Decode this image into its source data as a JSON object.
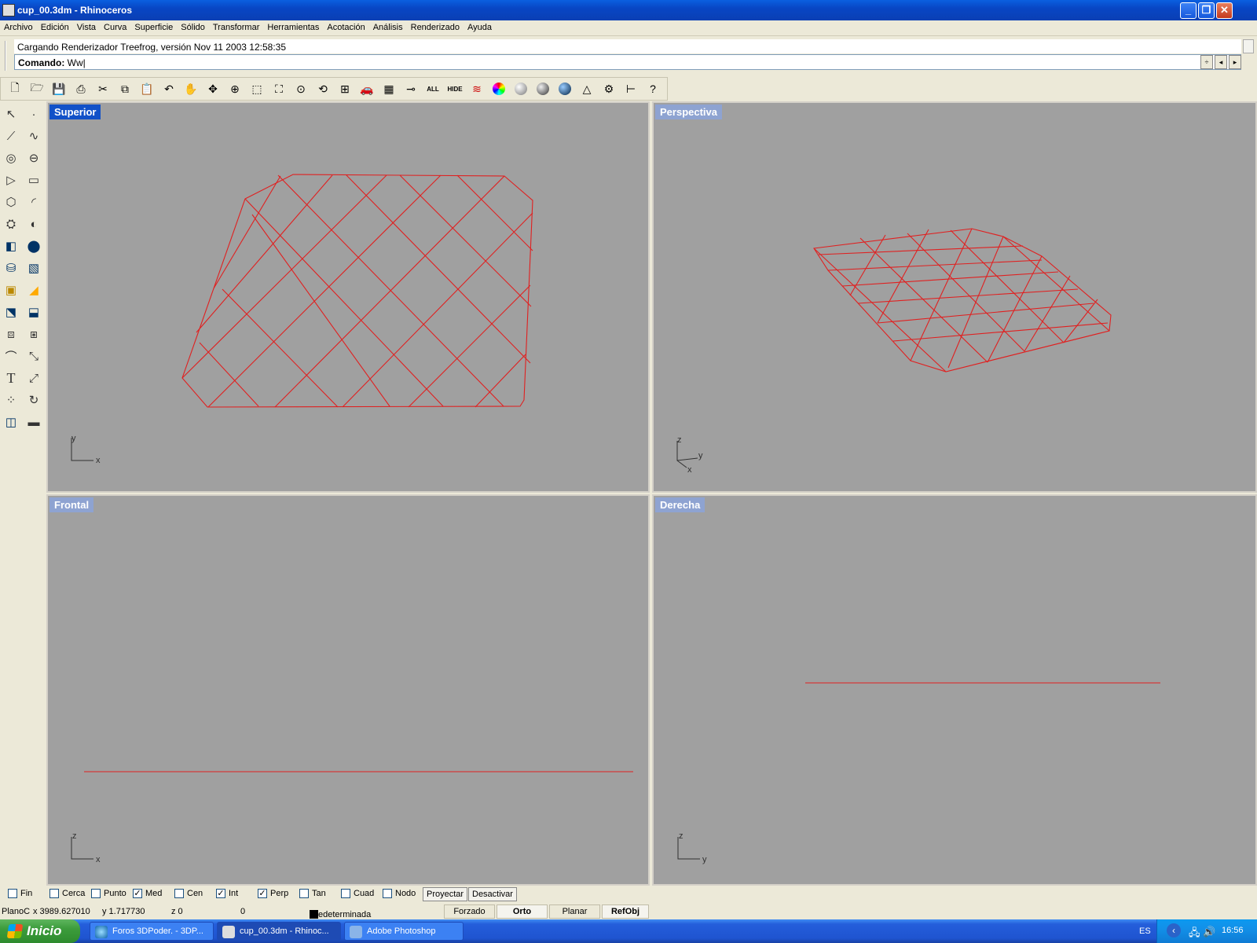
{
  "window": {
    "title": "cup_00.3dm - Rhinoceros",
    "minimize": "_",
    "restore": "❐",
    "close": "✕"
  },
  "menu": [
    "Archivo",
    "Edición",
    "Vista",
    "Curva",
    "Superficie",
    "Sólido",
    "Transformar",
    "Herramientas",
    "Acotación",
    "Análisis",
    "Renderizado",
    "Ayuda"
  ],
  "command": {
    "history": "Cargando Renderizador Treefrog, versión Nov 11 2003 12:58:35",
    "prompt": "Comando:",
    "value": "Ww"
  },
  "toolbar": {
    "icons": [
      "new-icon",
      "open-icon",
      "save-icon",
      "print-icon",
      "cut-icon",
      "copy-icon",
      "paste-icon",
      "undo-icon",
      "pan-icon",
      "rotate-view-icon",
      "zoom-dynamic-icon",
      "zoom-window-icon",
      "zoom-extents-icon",
      "zoom-selected-icon",
      "undo-view-icon",
      "four-viewports-icon",
      "car-icon",
      "grid-icon",
      "point-icon",
      "show-all-icon",
      "hide-icon",
      "layer-icon",
      "color-wheel-icon",
      "shaded-sphere-icon",
      "rendered-sphere-icon",
      "blue-sphere-icon",
      "light-icon",
      "settings-icon",
      "dimension-icon",
      "help-icon"
    ],
    "labels": {
      "all": "ALL",
      "hide": "HIDE"
    }
  },
  "left_toolbar": [
    "select-arrow-icon",
    "point-icon",
    "polyline-icon",
    "curve-icon",
    "circle-icon",
    "ellipse-icon",
    "polygon-icon",
    "rectangle-icon",
    "hexagon-icon",
    "arc-icon",
    "extrude-icon",
    "revolve-icon",
    "box-icon",
    "solid-icon",
    "cylinder-icon",
    "surface-icon",
    "box-edit-icon",
    "fillet-icon",
    "curve-edit-icon",
    "split-icon",
    "transform-icon",
    "array-icon",
    "curve-from-object-icon",
    "dimension-icon",
    "text-icon",
    "scale-icon",
    "array-grid-icon",
    "rotate-icon",
    "properties-icon",
    "line-icon"
  ],
  "left_toolbar_text": "T",
  "viewports": [
    {
      "name": "Superior",
      "active": true,
      "axes": [
        "y",
        "x"
      ]
    },
    {
      "name": "Perspectiva",
      "active": false,
      "axes": [
        "z",
        "y",
        "x"
      ]
    },
    {
      "name": "Frontal",
      "active": false,
      "axes": [
        "z",
        "x"
      ]
    },
    {
      "name": "Derecha",
      "active": false,
      "axes": [
        "z",
        "y"
      ]
    }
  ],
  "osnap": {
    "items": [
      {
        "label": "Fin",
        "checked": false
      },
      {
        "label": "Cerca",
        "checked": false
      },
      {
        "label": "Punto",
        "checked": false
      },
      {
        "label": "Med",
        "checked": true
      },
      {
        "label": "Cen",
        "checked": false
      },
      {
        "label": "Int",
        "checked": true
      },
      {
        "label": "Perp",
        "checked": true
      },
      {
        "label": "Tan",
        "checked": false
      },
      {
        "label": "Cuad",
        "checked": false
      },
      {
        "label": "Nodo",
        "checked": false
      }
    ],
    "project": "Proyectar",
    "disable": "Desactivar"
  },
  "status": {
    "plane": "PlanoC",
    "x": "x 3989.627010",
    "y": "y 1.717730",
    "z": "z 0",
    "extra": "0",
    "layer": "Predeterminada",
    "snap": "Forzado",
    "ortho": "Orto",
    "planar": "Planar",
    "osnap": "RefObj"
  },
  "taskbar": {
    "start": "Inicio",
    "tasks": [
      "Foros 3DPoder. - 3DP...",
      "cup_00.3dm - Rhinoc...",
      "Adobe Photoshop"
    ],
    "lang": "ES",
    "clock": "16:56"
  },
  "colors": {
    "curve": "#e02020",
    "viewport_bg": "#a0a0a0",
    "active_title": "#1151c8",
    "inactive_title": "#8ea3d1"
  }
}
